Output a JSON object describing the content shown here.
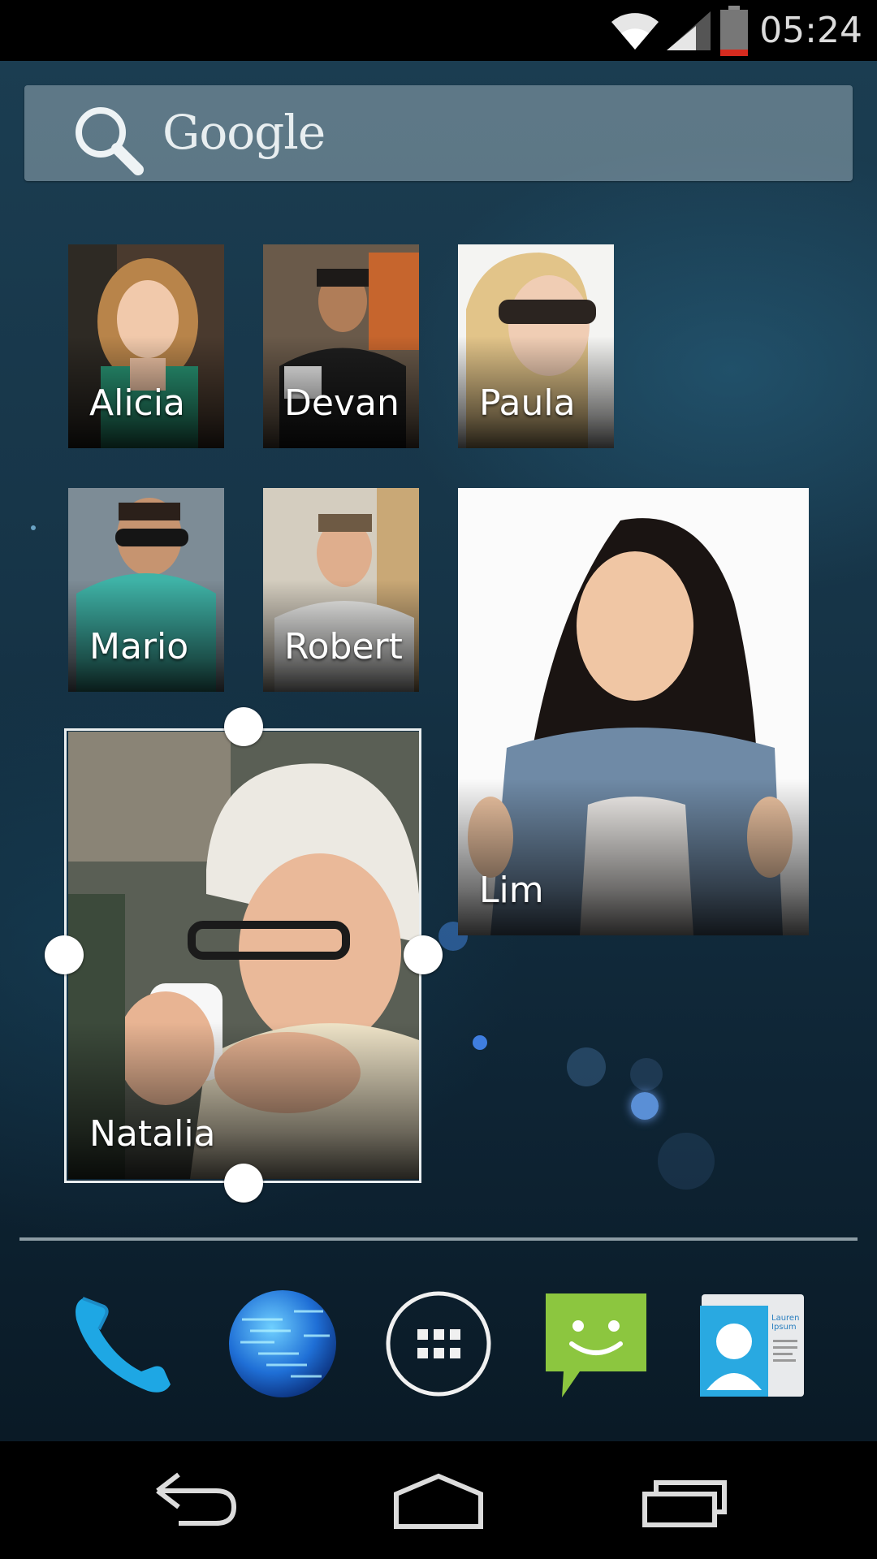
{
  "status_bar": {
    "time": "05:24",
    "icons": [
      "wifi-icon",
      "signal-icon",
      "battery-icon"
    ],
    "battery_color": "#d62b1f"
  },
  "search": {
    "logo_text": "Google",
    "icon": "search-icon"
  },
  "contacts": [
    {
      "name": "Alicia"
    },
    {
      "name": "Devan"
    },
    {
      "name": "Paula"
    },
    {
      "name": "Mario"
    },
    {
      "name": "Robert"
    },
    {
      "name": "Lim"
    },
    {
      "name": "Natalia"
    }
  ],
  "dock": {
    "apps": [
      "phone-icon",
      "browser-globe-icon",
      "all-apps-icon",
      "messaging-icon",
      "contacts-icon"
    ],
    "contacts_card_text": "Lauren Ipsum"
  },
  "nav_bar": {
    "buttons": [
      "back-icon",
      "home-icon",
      "recents-icon"
    ]
  },
  "colors": {
    "phone_blue": "#1ea7e4",
    "messaging_green": "#8cc63f",
    "wallpaper_top": "#1b3d51"
  }
}
